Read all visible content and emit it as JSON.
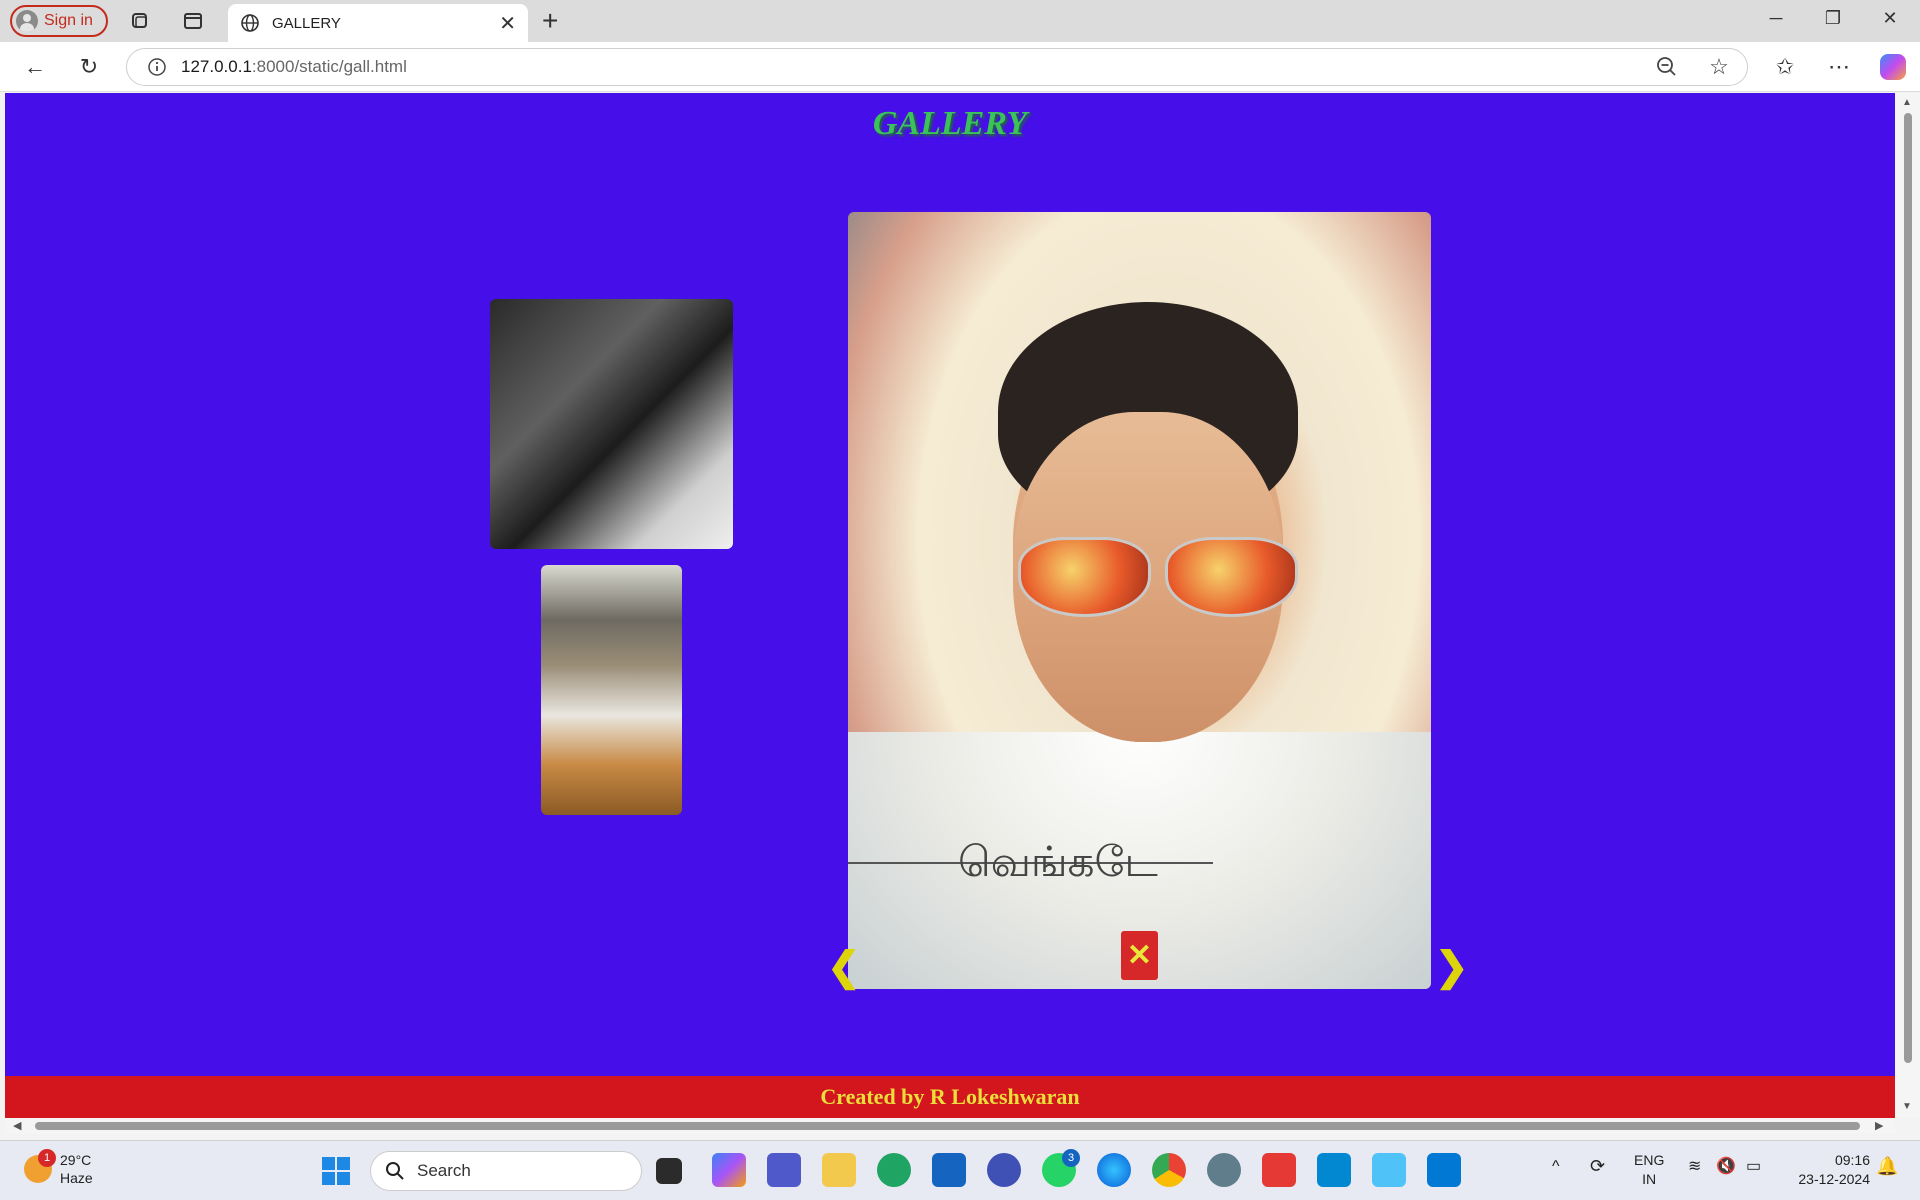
{
  "browser": {
    "signin_label": "Sign in",
    "tab_title": "GALLERY",
    "url_host": "127.0.0.1",
    "url_path": ":8000/static/gall.html"
  },
  "page": {
    "title": "GALLERY",
    "footer": "Created by R Lokeshwaran",
    "lightbox": {
      "close_glyph": "✕",
      "prev_glyph": "❮",
      "next_glyph": "❯",
      "signature": "வெங்கடே"
    }
  },
  "taskbar": {
    "weather_temp": "29°C",
    "weather_desc": "Haze",
    "weather_badge": "1",
    "search_label": "Search",
    "whatsapp_badge": "3",
    "lang_top": "ENG",
    "lang_bottom": "IN",
    "time": "09:16",
    "date": "23-12-2024"
  },
  "colors": {
    "page_background": "#460ee8",
    "title_color": "#3cc25a",
    "footer_background": "#d3161d",
    "footer_text": "#eadf3a",
    "arrow_color": "#ddd50a",
    "close_button": "#d62828"
  }
}
